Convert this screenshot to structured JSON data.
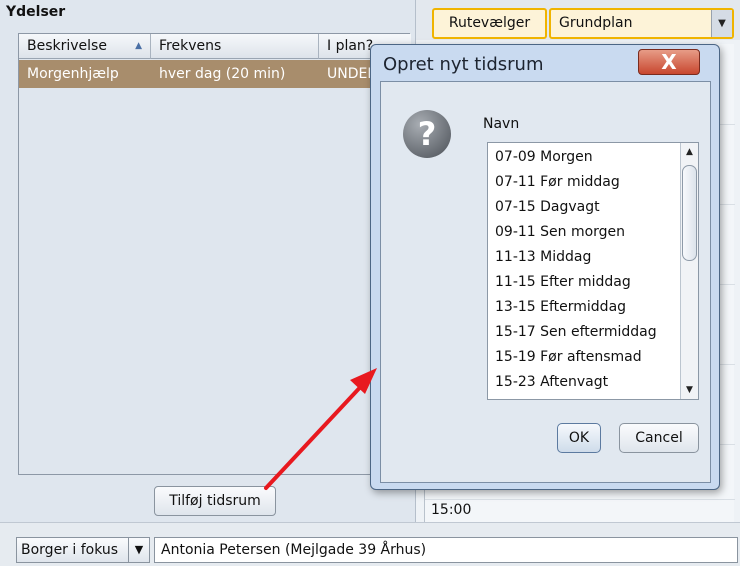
{
  "left_panel": {
    "title": "Ydelser",
    "columns": [
      "Beskrivelse",
      "Frekvens",
      "I plan?"
    ],
    "sort_indicator": "▲",
    "rows": [
      {
        "beskrivelse": "Morgenhjælp",
        "frekvens": "hver dag (20 min)",
        "i_plan": "UNDEF"
      }
    ],
    "add_button": "Tilføj tidsrum"
  },
  "right_panel": {
    "route_button": "Rutevælger",
    "plan_select": "Grundplan",
    "time_label": "15:00"
  },
  "bottom_bar": {
    "borger_label": "Borger i fokus",
    "citizen": "Antonia Petersen (Mejlgade 39 Århus)"
  },
  "dialog": {
    "title": "Opret nyt tidsrum",
    "close_glyph": "X",
    "question_glyph": "?",
    "list_label": "Navn",
    "items": [
      "07-09 Morgen",
      "07-11 Før middag",
      "07-15 Dagvagt",
      "09-11 Sen morgen",
      "11-13 Middag",
      "11-15 Efter middag",
      "13-15 Eftermiddag",
      "15-17 Sen eftermiddag",
      "15-19 Før aftensmad",
      "15-23 Aftenvagt"
    ],
    "ok": "OK",
    "cancel": "Cancel"
  },
  "colors": {
    "selected_row": "#a88d6c",
    "toolbar_accent": "#f0b400",
    "dialog_frame": "#c9daf0",
    "annotation_arrow": "#e8191f"
  }
}
